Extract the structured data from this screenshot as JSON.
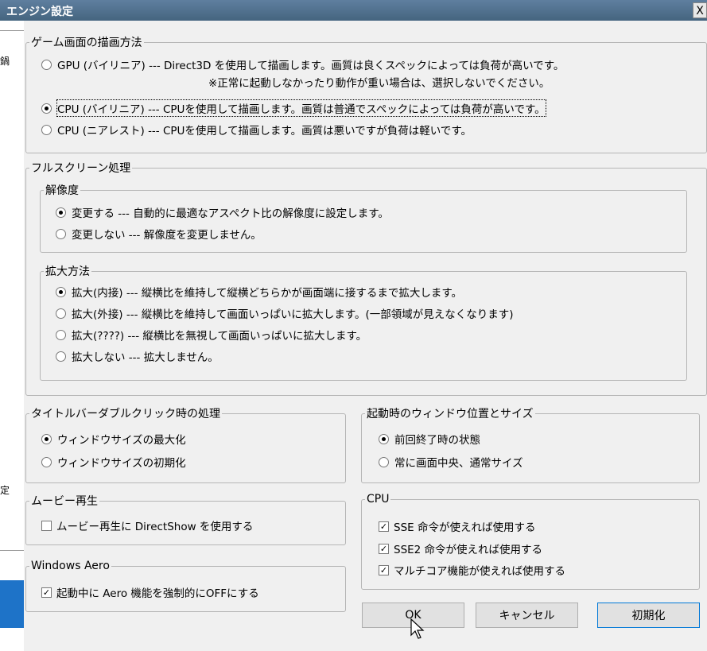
{
  "window": {
    "title": "エンジン設定",
    "close_glyph": "X"
  },
  "background": {
    "char1": "鍋",
    "char2": "定"
  },
  "render": {
    "legend": "ゲーム画面の描画方法",
    "options": [
      {
        "label": "GPU (バイリニア) --- Direct3D を使用して描画します。画質は良くスペックによっては負荷が高いです。",
        "selected": false
      },
      {
        "label": "CPU (バイリニア) --- CPUを使用して描画します。画質は普通でスペックによっては負荷が高いです。",
        "selected": true
      },
      {
        "label": "CPU (ニアレスト) --- CPUを使用して描画します。画質は悪いですが負荷は軽いです。",
        "selected": false
      }
    ],
    "note": "※正常に起動しなかったり動作が重い場合は、選択しないでください。"
  },
  "fullscreen": {
    "legend": "フルスクリーン処理",
    "resolution": {
      "legend": "解像度",
      "options": [
        {
          "label": "変更する --- 自動的に最適なアスペクト比の解像度に設定します。",
          "selected": true
        },
        {
          "label": "変更しない --- 解像度を変更しません。",
          "selected": false
        }
      ]
    },
    "scale": {
      "legend": "拡大方法",
      "options": [
        {
          "label": "拡大(内接) --- 縦横比を維持して縦横どちらかが画面端に接するまで拡大します。",
          "selected": true
        },
        {
          "label": "拡大(外接) --- 縦横比を維持して画面いっぱいに拡大します。(一部領域が見えなくなります)",
          "selected": false
        },
        {
          "label": "拡大(????) --- 縦横比を無視して画面いっぱいに拡大します。",
          "selected": false
        },
        {
          "label": "拡大しない --- 拡大しません。",
          "selected": false
        }
      ]
    }
  },
  "titlebar_dblclick": {
    "legend": "タイトルバーダブルクリック時の処理",
    "options": [
      {
        "label": "ウィンドウサイズの最大化",
        "selected": true
      },
      {
        "label": "ウィンドウサイズの初期化",
        "selected": false
      }
    ]
  },
  "startup": {
    "legend": "起動時のウィンドウ位置とサイズ",
    "options": [
      {
        "label": "前回終了時の状態",
        "selected": true
      },
      {
        "label": "常に画面中央、通常サイズ",
        "selected": false
      }
    ]
  },
  "movie": {
    "legend": "ムービー再生",
    "checks": [
      {
        "label": "ムービー再生に DirectShow を使用する",
        "checked": false
      }
    ]
  },
  "aero": {
    "legend": "Windows Aero",
    "checks": [
      {
        "label": "起動中に Aero 機能を強制的にOFFにする",
        "checked": true
      }
    ]
  },
  "cpu": {
    "legend": "CPU",
    "checks": [
      {
        "label": "SSE 命令が使えれば使用する",
        "checked": true
      },
      {
        "label": "SSE2 命令が使えれば使用する",
        "checked": true
      },
      {
        "label": "マルチコア機能が使えれば使用する",
        "checked": true
      }
    ]
  },
  "buttons": {
    "ok": "OK",
    "cancel": "キャンセル",
    "reset": "初期化"
  }
}
